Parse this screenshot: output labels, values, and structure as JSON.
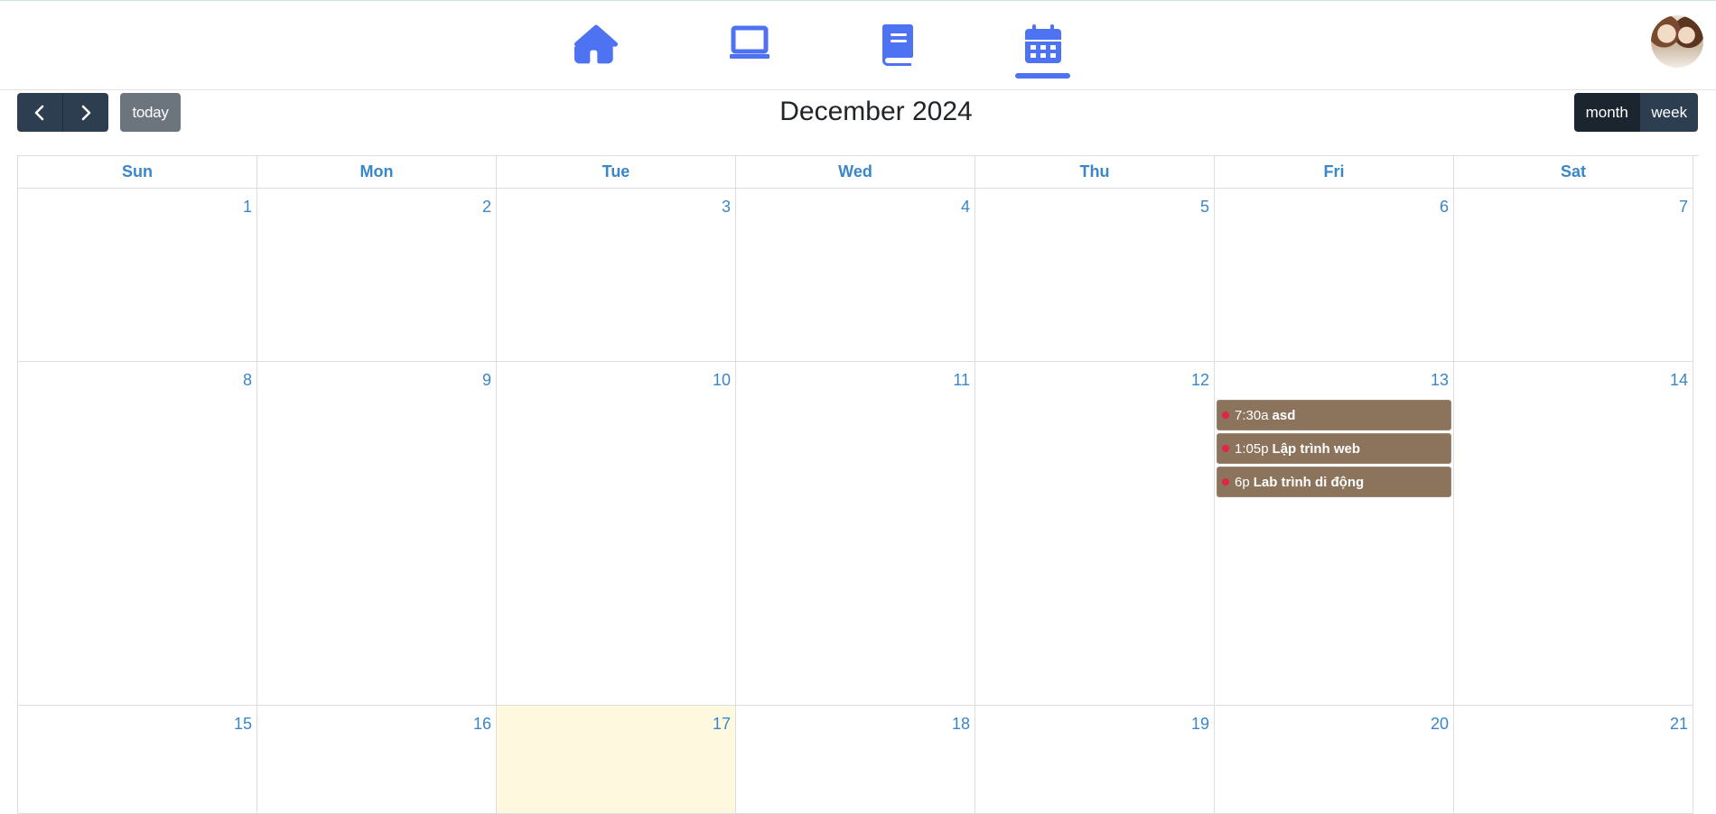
{
  "nav": {
    "items": [
      {
        "name": "home-icon"
      },
      {
        "name": "laptop-icon"
      },
      {
        "name": "book-icon"
      },
      {
        "name": "calendar-icon",
        "active": true
      }
    ],
    "accent_color": "#4d72f2"
  },
  "toolbar": {
    "prev_icon": "chevron-left-icon",
    "next_icon": "chevron-right-icon",
    "today_label": "today",
    "title": "December 2024",
    "month_label": "month",
    "week_label": "week"
  },
  "calendar": {
    "weekdays": [
      "Sun",
      "Mon",
      "Tue",
      "Wed",
      "Thu",
      "Fri",
      "Sat"
    ],
    "weeks": [
      [
        "1",
        "2",
        "3",
        "4",
        "5",
        "6",
        "7"
      ],
      [
        "8",
        "9",
        "10",
        "11",
        "12",
        "13",
        "14"
      ],
      [
        "15",
        "16",
        "17",
        "18",
        "19",
        "20",
        "21"
      ]
    ],
    "today": "17",
    "events_dec13": [
      {
        "time": "7:30a",
        "title": "asd"
      },
      {
        "time": "1:05p",
        "title": "Lập trình web"
      },
      {
        "time": "6p",
        "title": "Lab trình di động"
      }
    ],
    "event_color": "#8b735c",
    "event_dot_color": "#e4224a",
    "today_bg": "#fef8de"
  }
}
